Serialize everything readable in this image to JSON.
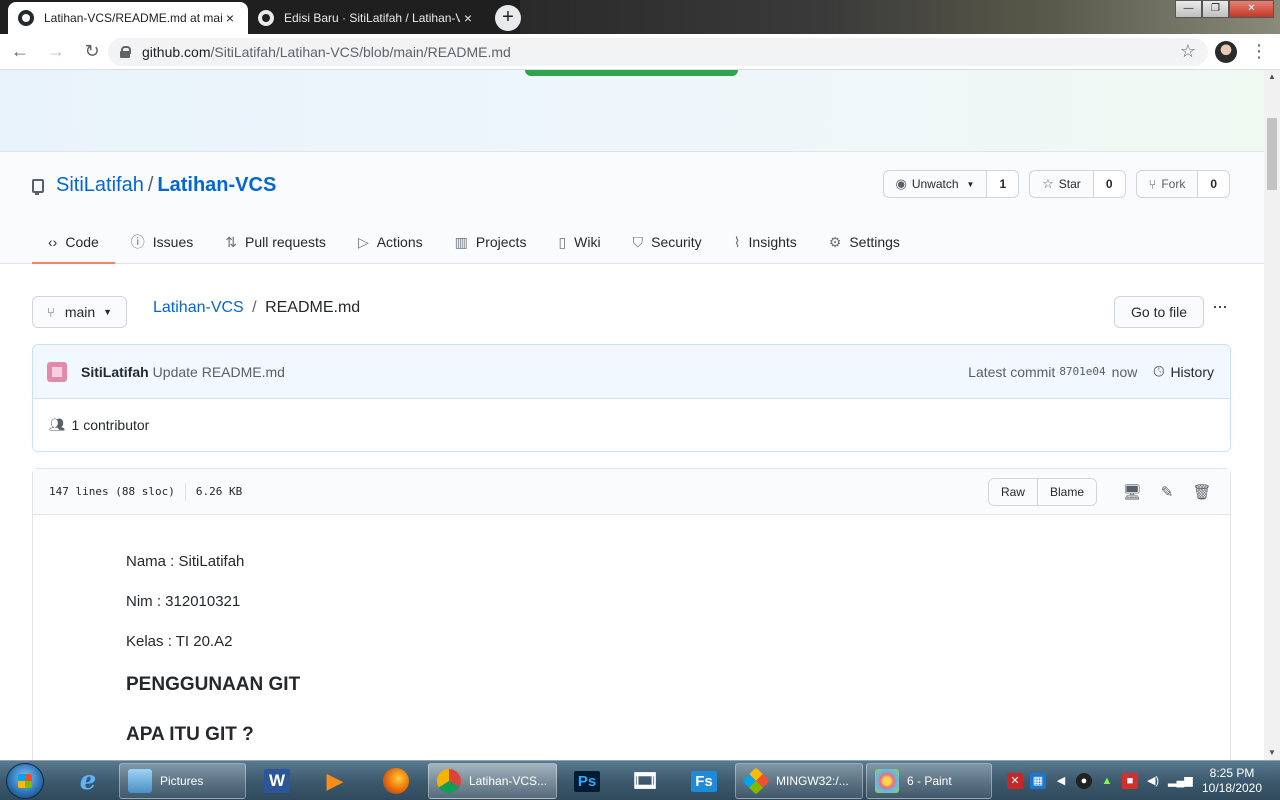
{
  "browser": {
    "tabs": [
      {
        "title": "Latihan-VCS/README.md at main",
        "active": true
      },
      {
        "title": "Edisi Baru · SitiLatifah / Latihan-VCS",
        "active": false
      }
    ],
    "new_tab": "+",
    "window_controls": {
      "minimize": "—",
      "maximize": "❐",
      "close": "✕"
    },
    "url_host": "github.com",
    "url_path": "/SitiLatifah/Latihan-VCS/blob/main/README.md"
  },
  "repo": {
    "owner": "SitiLatifah",
    "separator": "/",
    "name": "Latihan-VCS",
    "watch": {
      "label": "Unwatch",
      "count": "1"
    },
    "star": {
      "label": "Star",
      "count": "0"
    },
    "fork": {
      "label": "Fork",
      "count": "0"
    },
    "nav": [
      {
        "label": "Code",
        "icon": "code-icon",
        "glyph": "‹›"
      },
      {
        "label": "Issues",
        "icon": "issue-icon",
        "glyph": "ⓘ"
      },
      {
        "label": "Pull requests",
        "icon": "pull-request-icon",
        "glyph": "⇅"
      },
      {
        "label": "Actions",
        "icon": "play-icon",
        "glyph": "▷"
      },
      {
        "label": "Projects",
        "icon": "project-icon",
        "glyph": "▥"
      },
      {
        "label": "Wiki",
        "icon": "book-icon",
        "glyph": "▯"
      },
      {
        "label": "Security",
        "icon": "shield-icon",
        "glyph": "⛉"
      },
      {
        "label": "Insights",
        "icon": "graph-icon",
        "glyph": "⌇"
      },
      {
        "label": "Settings",
        "icon": "gear-icon",
        "glyph": "⚙"
      }
    ]
  },
  "file_nav": {
    "branch": "main",
    "breadcrumb_repo": "Latihan-VCS",
    "breadcrumb_sep": "/",
    "file_name": "README.md",
    "goto_file": "Go to file",
    "more": "···"
  },
  "commit": {
    "author": "SitiLatifah",
    "message": "Update README.md",
    "latest_label": "Latest commit",
    "sha": "8701e04",
    "time": "now",
    "history_label": "History",
    "contributors": "1 contributor"
  },
  "file": {
    "lines": "147 lines (88 sloc)",
    "size": "6.26 KB",
    "raw": "Raw",
    "blame": "Blame"
  },
  "readme": {
    "nama": "Nama : SitiLatifah",
    "nim": "Nim : 312010321",
    "kelas": "Kelas : TI 20.A2",
    "heading1": "PENGGUNAAN GIT",
    "heading2": "APA ITU GIT ?"
  },
  "taskbar": {
    "pictures": "Pictures",
    "chrome": "Latihan-VCS...",
    "mingw": "MINGW32:/...",
    "paint": "6 - Paint",
    "word_glyph": "W",
    "ps_glyph": "Ps",
    "fs_glyph": "Fs",
    "time": "8:25 PM",
    "date": "10/18/2020"
  }
}
